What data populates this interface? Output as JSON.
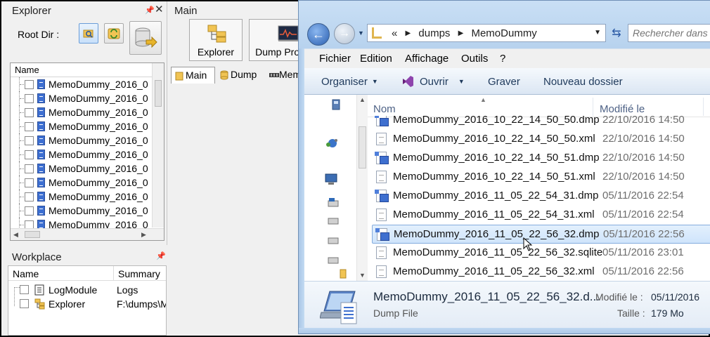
{
  "explorer_panel": {
    "title": "Explorer",
    "pin": "❠",
    "close": "✕",
    "root_dir_label": "Root Dir :",
    "tree_header": "Name",
    "tree_items": [
      "MemoDummy_2016_0",
      "MemoDummy_2016_0",
      "MemoDummy_2016_0",
      "MemoDummy_2016_0",
      "MemoDummy_2016_0",
      "MemoDummy_2016_0",
      "MemoDummy_2016_0",
      "MemoDummy_2016_0",
      "MemoDummy_2016_0",
      "MemoDummy_2016_0",
      "MemoDummy_2016_0"
    ]
  },
  "workplace_panel": {
    "title": "Workplace",
    "col_name": "Name",
    "col_summary": "Summary",
    "rows": [
      {
        "name": "LogModule",
        "summary": "Logs"
      },
      {
        "name": "Explorer",
        "summary": "F:\\dumps\\M"
      }
    ]
  },
  "main_panel": {
    "title": "Main",
    "buttons": [
      "Explorer",
      "Dump Process"
    ],
    "tabs": [
      "Main",
      "Dump",
      "Mem"
    ]
  },
  "window": {
    "address": {
      "chevron": "«",
      "crumbs": [
        "dumps",
        "MemoDummy"
      ]
    },
    "search_placeholder": "Rechercher dans",
    "menu": [
      "Fichier",
      "Edition",
      "Affichage",
      "Outils",
      "?"
    ],
    "commands": {
      "organize": "Organiser",
      "open": "Ouvrir",
      "burn": "Graver",
      "new_folder": "Nouveau dossier"
    },
    "columns": {
      "name": "Nom",
      "modified": "Modifié le"
    },
    "files": [
      {
        "name": "MemoDummy_2016_10_22_14_50_50.dmp",
        "date": "22/10/2016 14:50",
        "kind": "dmp"
      },
      {
        "name": "MemoDummy_2016_10_22_14_50_50.xml",
        "date": "22/10/2016 14:50",
        "kind": "xml"
      },
      {
        "name": "MemoDummy_2016_10_22_14_50_51.dmp",
        "date": "22/10/2016 14:50",
        "kind": "dmp"
      },
      {
        "name": "MemoDummy_2016_10_22_14_50_51.xml",
        "date": "22/10/2016 14:50",
        "kind": "xml"
      },
      {
        "name": "MemoDummy_2016_11_05_22_54_31.dmp",
        "date": "05/11/2016 22:54",
        "kind": "dmp"
      },
      {
        "name": "MemoDummy_2016_11_05_22_54_31.xml",
        "date": "05/11/2016 22:54",
        "kind": "xml"
      },
      {
        "name": "MemoDummy_2016_11_05_22_56_32.dmp",
        "date": "05/11/2016 22:56",
        "kind": "dmp",
        "selected": true
      },
      {
        "name": "MemoDummy_2016_11_05_22_56_32.sqlite",
        "date": "05/11/2016 23:01",
        "kind": "xml"
      },
      {
        "name": "MemoDummy_2016_11_05_22_56_32.xml",
        "date": "05/11/2016 22:56",
        "kind": "xml"
      }
    ],
    "details": {
      "name": "MemoDummy_2016_11_05_22_56_32.d...",
      "type": "Dump File",
      "modified_label": "Modifié le :",
      "modified_value": "05/11/2016",
      "size_label": "Taille :",
      "size_value": "179 Mo"
    }
  },
  "colors": {
    "window_frame": "#bed7f1",
    "selection": "#cfe4fb",
    "accent_blue": "#2a5fb0"
  }
}
